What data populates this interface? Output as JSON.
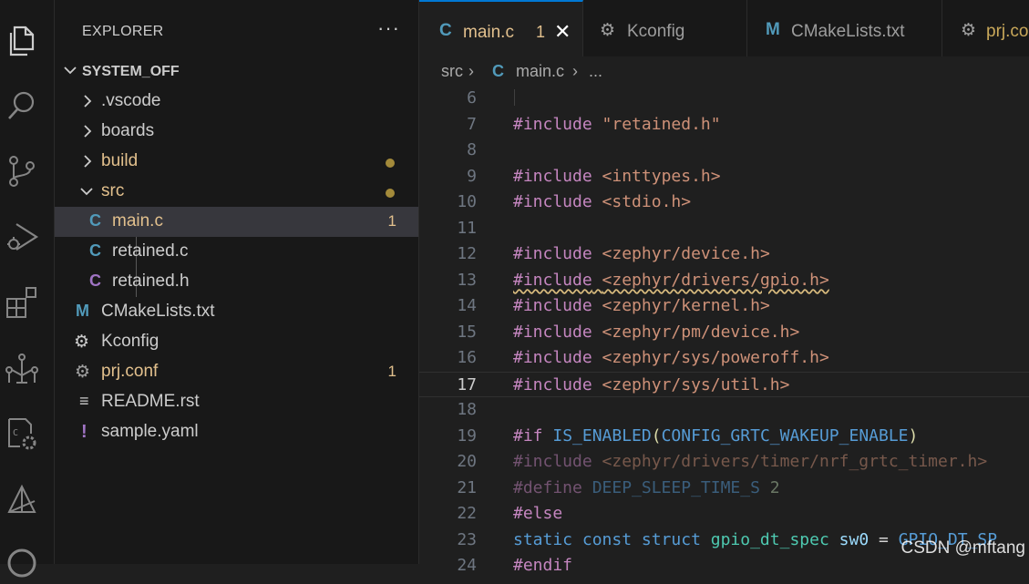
{
  "activity_bar": {
    "icons": [
      "files-icon",
      "search-icon",
      "source-control-icon",
      "run-debug-icon",
      "extensions-icon",
      "device-tree-icon",
      "settings-sync-icon",
      "nrf-connect-icon",
      "remote-icon"
    ]
  },
  "sidebar": {
    "title": "EXPLORER",
    "more": "···",
    "folder": "SYSTEM_OFF",
    "items": [
      {
        "label": ".vscode",
        "type": "folder"
      },
      {
        "label": "boards",
        "type": "folder"
      },
      {
        "label": "build",
        "type": "folder",
        "status": "modified"
      },
      {
        "label": "src",
        "type": "folder-open",
        "status": "modified"
      },
      {
        "label": "main.c",
        "type": "c-file",
        "badge": "1"
      },
      {
        "label": "retained.c",
        "type": "c-file"
      },
      {
        "label": "retained.h",
        "type": "h-file"
      },
      {
        "label": "CMakeLists.txt",
        "type": "cmake"
      },
      {
        "label": "Kconfig",
        "type": "kconfig"
      },
      {
        "label": "prj.conf",
        "type": "conf",
        "badge": "1"
      },
      {
        "label": "README.rst",
        "type": "text"
      },
      {
        "label": "sample.yaml",
        "type": "yaml"
      }
    ]
  },
  "tabs": [
    {
      "icon": "C",
      "label": "main.c",
      "badge": "1",
      "close": "✕"
    },
    {
      "icon": "⚙",
      "label": "Kconfig"
    },
    {
      "icon": "M",
      "label": "CMakeLists.txt"
    },
    {
      "icon": "⚙",
      "label": "prj.co"
    }
  ],
  "breadcrumb": {
    "folder": "src",
    "sep": "›",
    "file_icon": "C",
    "file": "main.c",
    "rest": "..."
  },
  "code": {
    "line_numbers": [
      "6",
      "7",
      "8",
      "9",
      "10",
      "11",
      "12",
      "13",
      "14",
      "15",
      "16",
      "17",
      "18",
      "19",
      "20",
      "21",
      "22",
      "23",
      "24"
    ],
    "lines": [
      "",
      "#include \"retained.h\"",
      "",
      "#include <inttypes.h>",
      "#include <stdio.h>",
      "",
      "#include <zephyr/device.h>",
      "#include <zephyr/drivers/gpio.h>",
      "#include <zephyr/kernel.h>",
      "#include <zephyr/pm/device.h>",
      "#include <zephyr/sys/poweroff.h>",
      "#include <zephyr/sys/util.h>",
      "",
      "#if IS_ENABLED(CONFIG_GRTC_WAKEUP_ENABLE)",
      "#include <zephyr/drivers/timer/nrf_grtc_timer.h>",
      "#define DEEP_SLEEP_TIME_S 2",
      "#else",
      "static const struct gpio_dt_spec sw0 = GPIO_DT_SP",
      "#endif"
    ],
    "current_line": "17"
  },
  "watermark": "CSDN @mftang",
  "colors": {
    "accent": "#0078d4",
    "modified": "#e2c08d",
    "c_icon": "#519aba",
    "h_icon": "#a074c4"
  }
}
